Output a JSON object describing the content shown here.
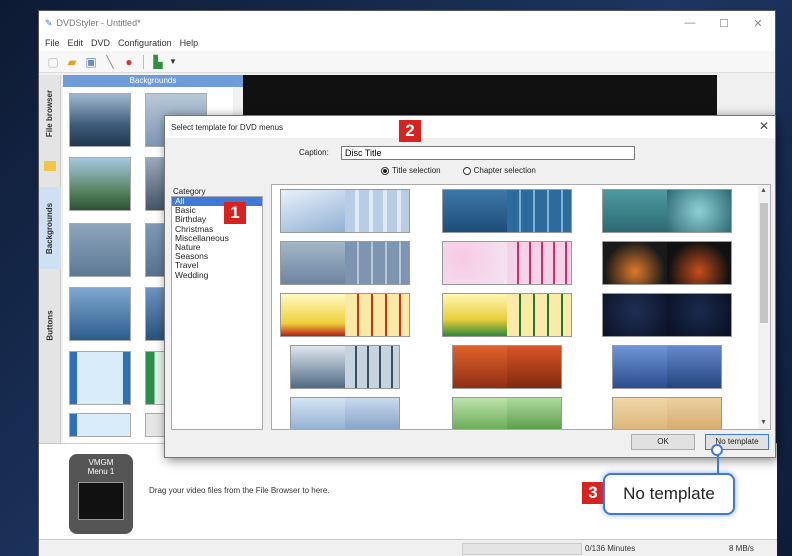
{
  "window": {
    "title": "DVDStyler - Untitled*",
    "minimize_glyph": "—",
    "maximize_glyph": "☐",
    "close_glyph": "✕"
  },
  "menu": {
    "items": [
      "File",
      "Edit",
      "DVD",
      "Configuration",
      "Help"
    ]
  },
  "toolbar": {
    "icons": [
      "new-icon",
      "open-icon",
      "save-icon",
      "settings-icon",
      "burn-icon",
      "run-icon"
    ]
  },
  "sidebar": {
    "tabs": [
      "File browser",
      "Backgrounds",
      "Buttons"
    ],
    "active_tab": "Backgrounds"
  },
  "browser": {
    "header": "Backgrounds"
  },
  "menu_preview": {
    "label_1": "VMGM",
    "label_2": "Menu 1"
  },
  "bottom": {
    "drag_text": "Drag your video files from the File Browser to here."
  },
  "status": {
    "duration": "0/136 Minutes",
    "speed": "8 MB/s"
  },
  "dialog": {
    "title": "Select template for DVD menus",
    "caption_label": "Caption:",
    "caption_value": "Disc Title",
    "radio_title": "Title selection",
    "radio_chapter": "Chapter selection",
    "category_label": "Category",
    "categories": [
      "All",
      "Basic",
      "Birthday",
      "Christmas",
      "Miscellaneous",
      "Nature",
      "Seasons",
      "Travel",
      "Wedding"
    ],
    "selected_category": "All",
    "ok_label": "OK",
    "no_template_label": "No template"
  },
  "annotations": {
    "badge_1": "1",
    "badge_2": "2",
    "badge_3": "3",
    "callout_text": "No template"
  },
  "colors": {
    "accent": "#3f78d6",
    "badge": "#d7231f"
  }
}
